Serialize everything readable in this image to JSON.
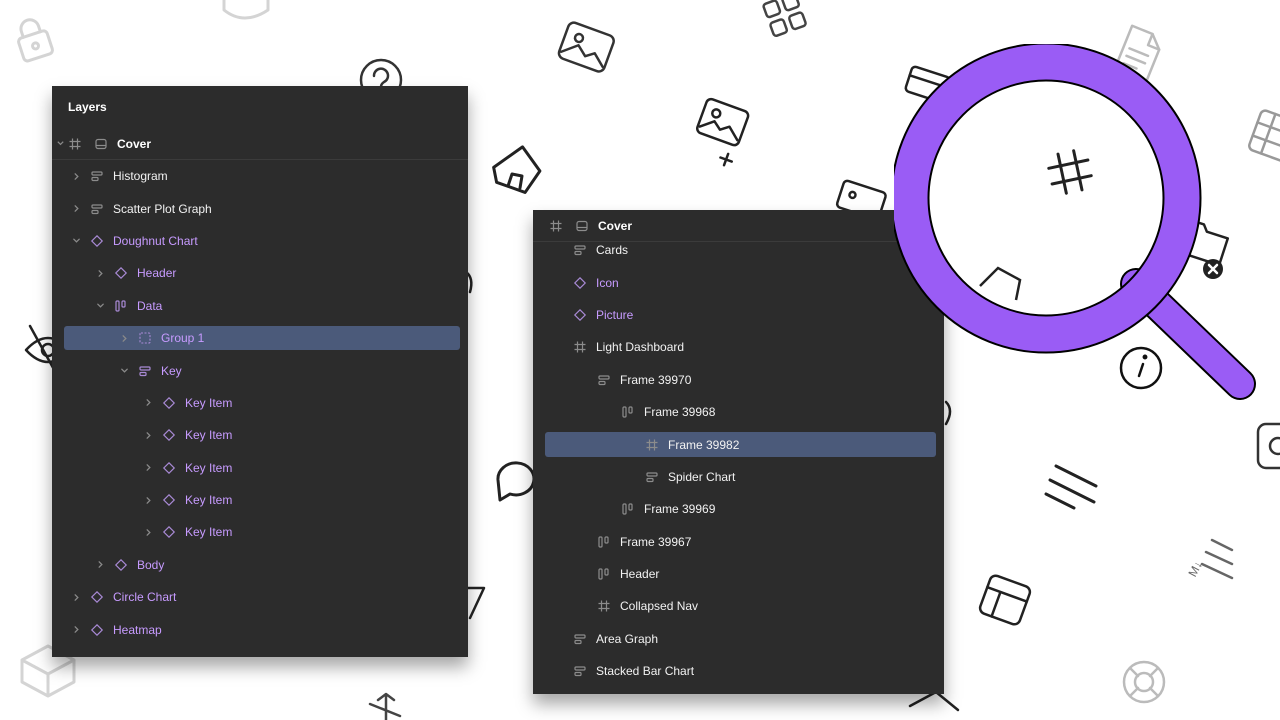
{
  "colors": {
    "panel_bg": "#2c2c2c",
    "selection": "#4b5a7a",
    "component_purple": "#c79bff",
    "magnifier_purple": "#9a5cf5"
  },
  "layers_panel": {
    "title": "Layers",
    "root": {
      "label": "Cover",
      "icons": [
        "frame-hash-icon",
        "page-icon"
      ]
    },
    "rows": [
      {
        "label": "Histogram",
        "icon": "autolayout-rows-icon",
        "indent": 0,
        "chevron": "right",
        "purple": false,
        "selected": false
      },
      {
        "label": "Scatter Plot Graph",
        "icon": "autolayout-rows-icon",
        "indent": 0,
        "chevron": "right",
        "purple": false,
        "selected": false
      },
      {
        "label": "Doughnut Chart",
        "icon": "component-diamond-icon",
        "indent": 0,
        "chevron": "down",
        "purple": true,
        "selected": false
      },
      {
        "label": "Header",
        "icon": "component-diamond-icon",
        "indent": 1,
        "chevron": "right",
        "purple": true,
        "selected": false
      },
      {
        "label": "Data",
        "icon": "autolayout-columns-icon",
        "indent": 1,
        "chevron": "down",
        "purple": true,
        "selected": false
      },
      {
        "label": "Group 1",
        "icon": "group-dashed-icon",
        "indent": 2,
        "chevron": "right",
        "purple": true,
        "selected": true
      },
      {
        "label": "Key",
        "icon": "autolayout-rows-icon",
        "indent": 2,
        "chevron": "down",
        "purple": true,
        "selected": false
      },
      {
        "label": "Key Item",
        "icon": "component-diamond-icon",
        "indent": 3,
        "chevron": "right",
        "purple": true,
        "selected": false
      },
      {
        "label": "Key Item",
        "icon": "component-diamond-icon",
        "indent": 3,
        "chevron": "right",
        "purple": true,
        "selected": false
      },
      {
        "label": "Key Item",
        "icon": "component-diamond-icon",
        "indent": 3,
        "chevron": "right",
        "purple": true,
        "selected": false
      },
      {
        "label": "Key Item",
        "icon": "component-diamond-icon",
        "indent": 3,
        "chevron": "right",
        "purple": true,
        "selected": false
      },
      {
        "label": "Key Item",
        "icon": "component-diamond-icon",
        "indent": 3,
        "chevron": "right",
        "purple": true,
        "selected": false
      },
      {
        "label": "Body",
        "icon": "component-diamond-icon",
        "indent": 1,
        "chevron": "right",
        "purple": true,
        "selected": false
      },
      {
        "label": "Circle Chart",
        "icon": "component-diamond-icon",
        "indent": 0,
        "chevron": "right",
        "purple": true,
        "selected": false
      },
      {
        "label": "Heatmap",
        "icon": "component-diamond-icon",
        "indent": 0,
        "chevron": "right",
        "purple": true,
        "selected": false
      }
    ]
  },
  "cover_panel": {
    "root": {
      "label": "Cover",
      "icons": [
        "frame-hash-icon",
        "page-icon"
      ]
    },
    "rows": [
      {
        "label": "Cards",
        "icon": "autolayout-rows-icon",
        "indent": 0,
        "purple": false,
        "selected": false
      },
      {
        "label": "Icon",
        "icon": "component-diamond-icon",
        "indent": 0,
        "purple": true,
        "selected": false
      },
      {
        "label": "Picture",
        "icon": "component-diamond-icon",
        "indent": 0,
        "purple": true,
        "selected": false
      },
      {
        "label": "Light Dashboard",
        "icon": "frame-hash-icon",
        "indent": 0,
        "purple": false,
        "selected": false
      },
      {
        "label": "Frame 39970",
        "icon": "autolayout-rows-icon",
        "indent": 1,
        "purple": false,
        "selected": false
      },
      {
        "label": "Frame 39968",
        "icon": "autolayout-columns-icon",
        "indent": 2,
        "purple": false,
        "selected": false
      },
      {
        "label": "Frame 39982",
        "icon": "frame-hash-icon",
        "indent": 3,
        "purple": false,
        "selected": true
      },
      {
        "label": "Spider Chart",
        "icon": "autolayout-rows-icon",
        "indent": 3,
        "purple": false,
        "selected": false
      },
      {
        "label": "Frame 39969",
        "icon": "autolayout-columns-icon",
        "indent": 2,
        "purple": false,
        "selected": false
      },
      {
        "label": "Frame 39967",
        "icon": "autolayout-columns-icon",
        "indent": 1,
        "purple": false,
        "selected": false
      },
      {
        "label": "Header",
        "icon": "autolayout-columns-icon",
        "indent": 1,
        "purple": false,
        "selected": false
      },
      {
        "label": "Collapsed Nav",
        "icon": "frame-hash-icon",
        "indent": 1,
        "purple": false,
        "selected": false
      },
      {
        "label": "Area Graph",
        "icon": "autolayout-rows-icon",
        "indent": 0,
        "purple": false,
        "selected": false
      },
      {
        "label": "Stacked Bar Chart",
        "icon": "autolayout-rows-icon",
        "indent": 0,
        "purple": false,
        "selected": false
      }
    ]
  },
  "background_icons": [
    "lock-icon",
    "shield-icon",
    "grid-apps-icon",
    "image-icon",
    "help-icon",
    "document-icon",
    "home-icon",
    "image-add-icon",
    "card-icon",
    "table-icon",
    "eye-off-icon",
    "folder-remove-icon",
    "info-icon",
    "chat-icon",
    "speed-lines-icon",
    "sort-icon",
    "layout-icon",
    "box-icon",
    "arrows-icon",
    "lifebuoy-icon",
    "camera-icon"
  ],
  "magnifier": {
    "icon": "magnifier-icon",
    "inner_icon": "hash-icon"
  }
}
